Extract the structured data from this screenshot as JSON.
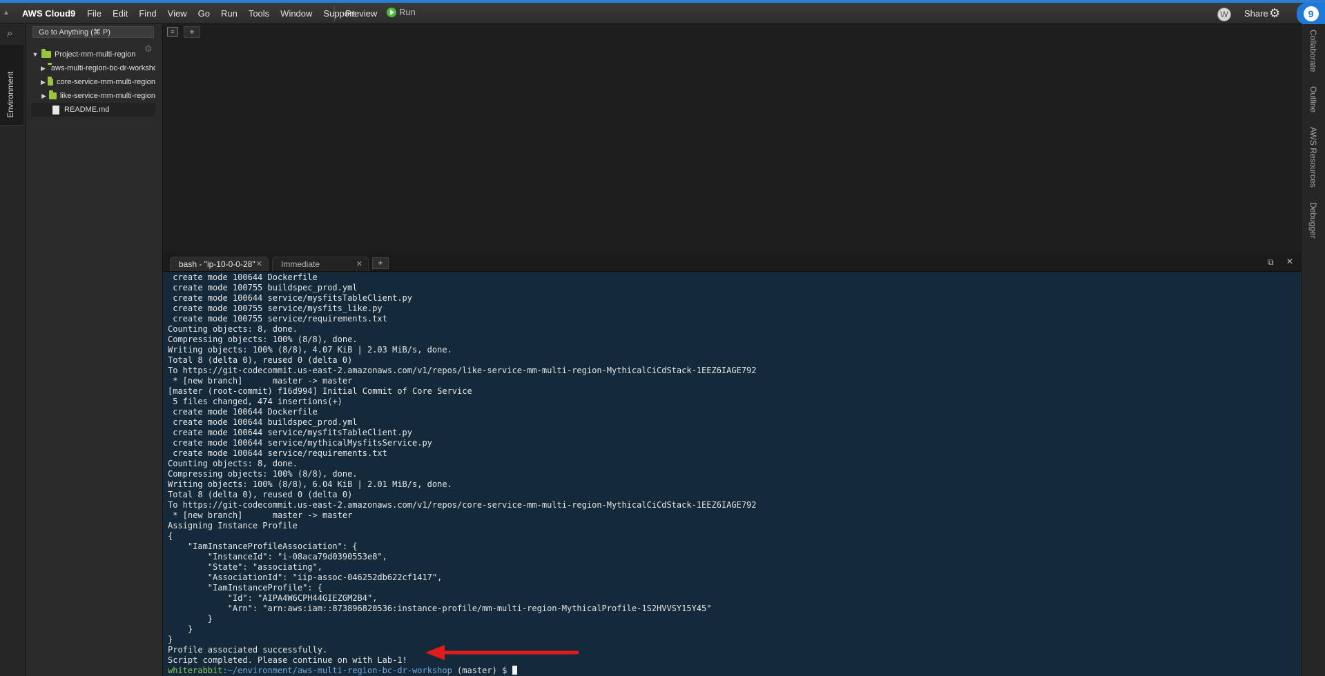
{
  "app": {
    "brand": "AWS Cloud9",
    "menus": [
      "File",
      "Edit",
      "Find",
      "View",
      "Go",
      "Run",
      "Tools",
      "Window",
      "Support"
    ],
    "preview_label": "Preview",
    "run_label": "Run",
    "share_label": "Share",
    "avatar_letter": "W",
    "notification_count": "9"
  },
  "left_panel": {
    "search_placeholder": "Go to Anything (⌘ P)",
    "environment_tab": "Environment"
  },
  "file_tree": {
    "root": "Project-mm-multi-region",
    "children": [
      {
        "type": "folder",
        "label": "aws-multi-region-bc-dr-workshop"
      },
      {
        "type": "folder",
        "label": "core-service-mm-multi-region"
      },
      {
        "type": "folder",
        "label": "like-service-mm-multi-region"
      },
      {
        "type": "file",
        "label": "README.md"
      }
    ]
  },
  "right_panel": {
    "tabs": [
      "Collaborate",
      "Outline",
      "AWS Resources",
      "Debugger"
    ]
  },
  "terminal": {
    "tabs": [
      {
        "label": "bash - \"ip-10-0-0-28\"",
        "active": true
      },
      {
        "label": "Immediate",
        "active": false
      }
    ],
    "lines": [
      " create mode 100644 Dockerfile",
      " create mode 100755 buildspec_prod.yml",
      " create mode 100644 service/mysfitsTableClient.py",
      " create mode 100755 service/mysfits_like.py",
      " create mode 100755 service/requirements.txt",
      "Counting objects: 8, done.",
      "Compressing objects: 100% (8/8), done.",
      "Writing objects: 100% (8/8), 4.07 KiB | 2.03 MiB/s, done.",
      "Total 8 (delta 0), reused 0 (delta 0)",
      "To https://git-codecommit.us-east-2.amazonaws.com/v1/repos/like-service-mm-multi-region-MythicalCiCdStack-1EEZ6IAGE792",
      " * [new branch]      master -> master",
      "[master (root-commit) f16d994] Initial Commit of Core Service",
      " 5 files changed, 474 insertions(+)",
      " create mode 100644 Dockerfile",
      " create mode 100644 buildspec_prod.yml",
      " create mode 100644 service/mysfitsTableClient.py",
      " create mode 100644 service/mythicalMysfitsService.py",
      " create mode 100644 service/requirements.txt",
      "Counting objects: 8, done.",
      "Compressing objects: 100% (8/8), done.",
      "Writing objects: 100% (8/8), 6.04 KiB | 2.01 MiB/s, done.",
      "Total 8 (delta 0), reused 0 (delta 0)",
      "To https://git-codecommit.us-east-2.amazonaws.com/v1/repos/core-service-mm-multi-region-MythicalCiCdStack-1EEZ6IAGE792",
      " * [new branch]      master -> master",
      "Assigning Instance Profile",
      "{",
      "    \"IamInstanceProfileAssociation\": {",
      "        \"InstanceId\": \"i-08aca79d0390553e8\",",
      "        \"State\": \"associating\",",
      "        \"AssociationId\": \"iip-assoc-046252db622cf1417\",",
      "        \"IamInstanceProfile\": {",
      "            \"Id\": \"AIPA4W6CPH44GIEZGM2B4\",",
      "            \"Arn\": \"arn:aws:iam::873896820536:instance-profile/mm-multi-region-MythicalProfile-1S2HVVSY15Y45\"",
      "        }",
      "    }",
      "}",
      "Profile associated successfully.",
      "Script completed. Please continue on with Lab-1!"
    ],
    "prompt": {
      "user": "whiterabbit",
      "path": ":~/environment/aws-multi-region-bc-dr-workshop",
      "branch": " (master) $ "
    }
  },
  "colors": {
    "annotation_arrow": "#e01b1b",
    "terminal_bg": "#14293a",
    "brand_accent": "#1f79d8",
    "folder_icon": "#9ac43c"
  }
}
